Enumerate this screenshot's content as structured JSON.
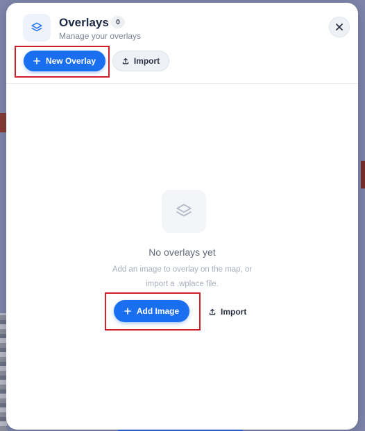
{
  "panel": {
    "title": "Overlays",
    "count": "0",
    "subtitle": "Manage your overlays",
    "icon": "layers-icon",
    "close_icon": "close-icon"
  },
  "toolbar": {
    "new_overlay_label": "New Overlay",
    "import_label": "Import"
  },
  "empty_state": {
    "icon": "layers-icon",
    "title": "No overlays yet",
    "description_line1": "Add an image to overlay on the map, or",
    "description_line2": "import a .wplace file.",
    "add_image_label": "Add Image",
    "import_label": "Import"
  },
  "colors": {
    "accent": "#1a6ef0",
    "highlight": "#d01f2b",
    "title_text": "#1f2a44",
    "muted_text": "#7b8496"
  }
}
